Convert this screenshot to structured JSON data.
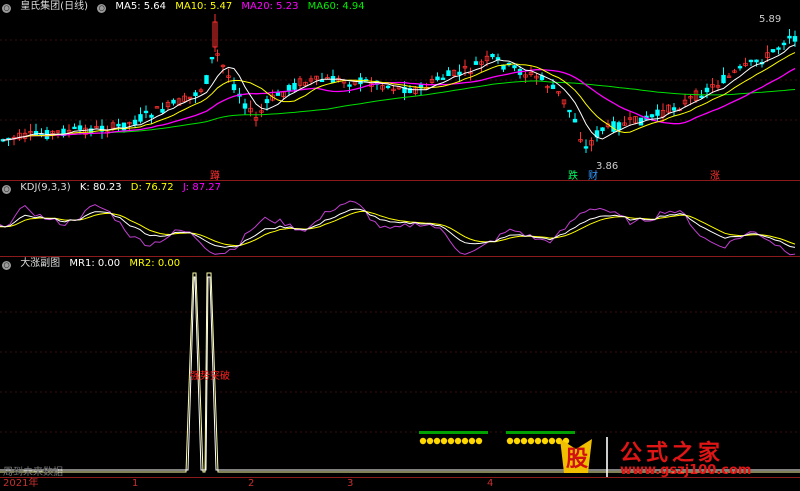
{
  "main": {
    "title": "皇氏集团(日线)",
    "ma": [
      {
        "label": "MA5: 5.64",
        "color": "#ffffff"
      },
      {
        "label": "MA10: 5.47",
        "color": "#ffff00"
      },
      {
        "label": "MA20: 5.23",
        "color": "#ff00ff"
      },
      {
        "label": "MA60: 4.94",
        "color": "#00e000"
      }
    ],
    "high_label": "5.89",
    "low_label": "3.86",
    "markers": {
      "a": "蹲",
      "b": "跌",
      "c": "财",
      "d": "涨"
    }
  },
  "kdj": {
    "title": "KDJ(9,3,3)",
    "k": "K: 80.23",
    "d": "D: 76.72",
    "j": "J: 87.27"
  },
  "sub": {
    "title": "大涨副图",
    "mr1": "MR1: 0.00",
    "mr2": "MR2: 0.00",
    "annotation": "强势突破",
    "footer": "周到未来数据"
  },
  "axis": {
    "labels": [
      "2021年",
      "1",
      "2",
      "3",
      "4"
    ]
  },
  "logo": {
    "glyph": "股",
    "name": "公式之家",
    "url": "www.gszj100.com"
  },
  "colors": {
    "up": "#ff3030",
    "down": "#00ffff",
    "panel_border": "#8b1a1a",
    "ma5": "#ffffff",
    "ma10": "#ffff00",
    "ma20": "#ff00ff",
    "ma60": "#00e000"
  }
}
